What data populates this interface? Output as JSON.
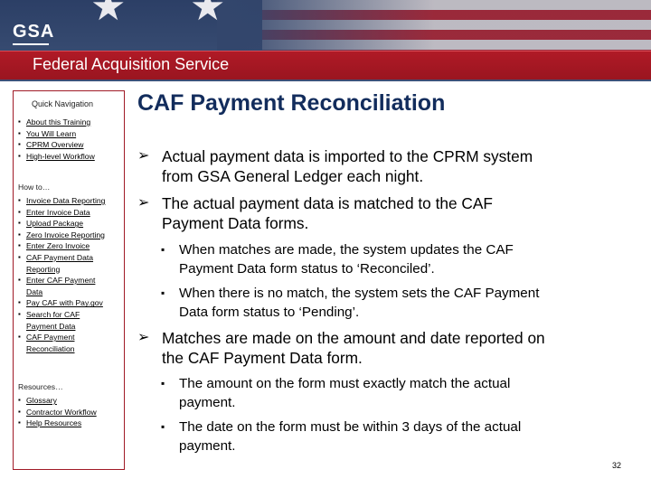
{
  "header": {
    "logo_text": "GSA",
    "service": "Federal Acquisition Service"
  },
  "sidebar": {
    "title": "Quick Navigation",
    "group1": [
      "About this Training",
      "You Will Learn",
      "CPRM Overview",
      "High-level Workflow"
    ],
    "howto_label": "How to…",
    "group2": [
      "Invoice Data Reporting",
      "Enter Invoice Data",
      "Upload Package",
      "Zero Invoice Reporting",
      "Enter Zero Invoice",
      "CAF Payment Data Reporting",
      "Enter CAF Payment Data",
      "Pay CAF with Pay.gov",
      "Search for CAF Payment Data",
      "CAF Payment Reconciliation"
    ],
    "resources_label": "Resources…",
    "group3": [
      "Glossary",
      "Contractor Workflow",
      "Help Resources"
    ]
  },
  "main": {
    "title": "CAF Payment Reconciliation",
    "b1_line1": "Actual payment data is imported to the CPRM system",
    "b1_line2": "from GSA General Ledger each night.",
    "b2_line1": "The actual payment data is matched to the CAF",
    "b2_line2": "Payment Data forms.",
    "s1_line1": "When matches are made, the system updates the CAF",
    "s1_line2": "Payment Data form status to ‘Reconciled’.",
    "s2_line1": "When there is no match, the system sets the CAF Payment",
    "s2_line2": "Data form status to ‘Pending’.",
    "b3_line1": "Matches are made on the amount and date reported on",
    "b3_line2": "the CAF Payment Data form.",
    "s3_line1": "The amount on the form must exactly match the actual",
    "s3_line2": "payment.",
    "s4_line1": "The date on the form must be within 3 days of the actual",
    "s4_line2": "payment."
  },
  "page_number": "32"
}
